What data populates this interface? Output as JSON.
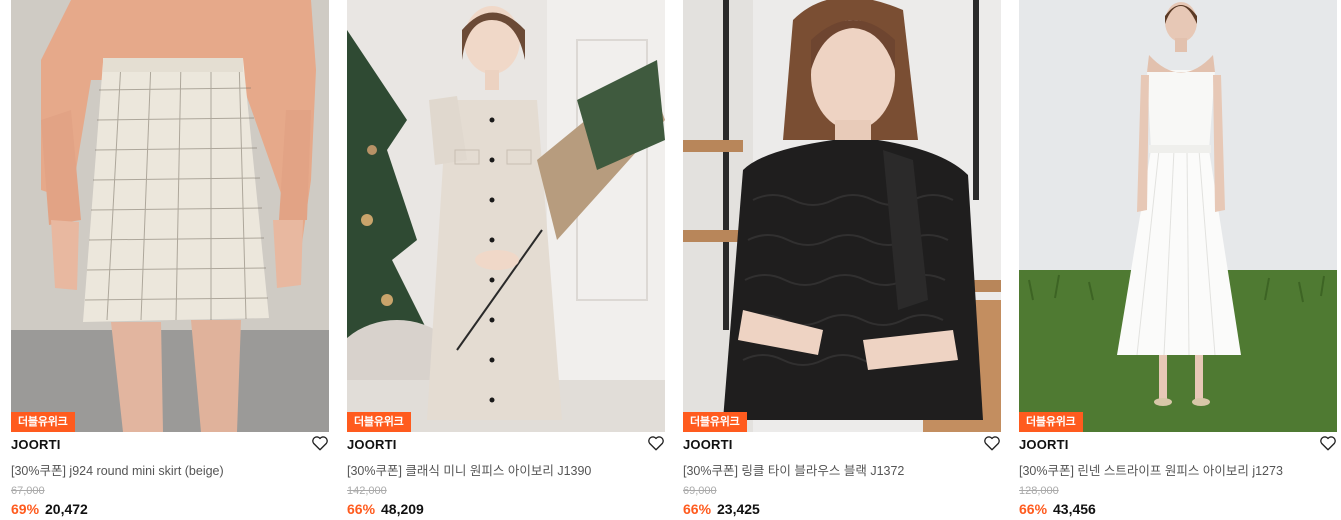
{
  "products": [
    {
      "badge": "더블유위크",
      "brand": "JOORTI",
      "name": "[30%쿠폰] j924 round mini skirt (beige)",
      "original_price": "67,000",
      "discount": "69%",
      "price": "20,472"
    },
    {
      "badge": "더블유위크",
      "brand": "JOORTI",
      "name": "[30%쿠폰] 클래식 미니 원피스 아이보리 J1390",
      "original_price": "142,000",
      "discount": "66%",
      "price": "48,209"
    },
    {
      "badge": "더블유위크",
      "brand": "JOORTI",
      "name": "[30%쿠폰] 링클 타이 블라우스 블랙 J1372",
      "original_price": "69,000",
      "discount": "66%",
      "price": "23,425"
    },
    {
      "badge": "더블유위크",
      "brand": "JOORTI",
      "name": "[30%쿠폰] 린넨 스트라이프 원피스 아이보리 j1273",
      "original_price": "128,000",
      "discount": "66%",
      "price": "43,456"
    }
  ],
  "icons": {
    "wishlist": "heart-outline-icon"
  },
  "colors": {
    "accent": "#ff5b1e",
    "text": "#111111",
    "muted": "#aaaaaa"
  }
}
